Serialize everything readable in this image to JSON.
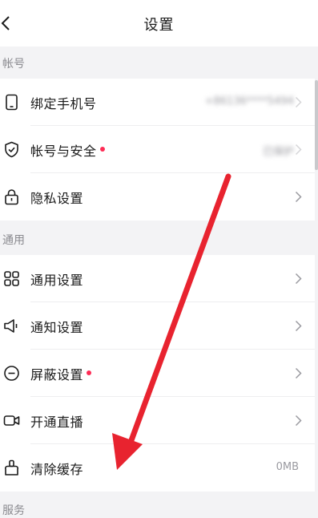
{
  "header": {
    "title": "设置"
  },
  "sections": {
    "account": {
      "label": "帐号"
    },
    "general": {
      "label": "通用"
    },
    "service": {
      "label": "服务"
    }
  },
  "account_items": [
    {
      "label": "绑定手机号",
      "value": "+86136****5494",
      "icon": "phone-icon"
    },
    {
      "label": "帐号与安全",
      "value": "已保护",
      "icon": "shield-check-icon",
      "dot": true
    },
    {
      "label": "隐私设置",
      "value": "",
      "icon": "lock-icon"
    }
  ],
  "general_items": [
    {
      "label": "通用设置",
      "value": "",
      "icon": "grid-icon"
    },
    {
      "label": "通知设置",
      "value": "",
      "icon": "speaker-icon"
    },
    {
      "label": "屏蔽设置",
      "value": "",
      "icon": "block-icon",
      "dot": true
    },
    {
      "label": "开通直播",
      "value": "",
      "icon": "video-camera-icon"
    },
    {
      "label": "清除缓存",
      "value": "0MB",
      "icon": "broom-icon"
    }
  ],
  "colors": {
    "badge_dot": "#fe2c55",
    "annotation_arrow": "#e8232f",
    "background": "#f3f3f5"
  }
}
